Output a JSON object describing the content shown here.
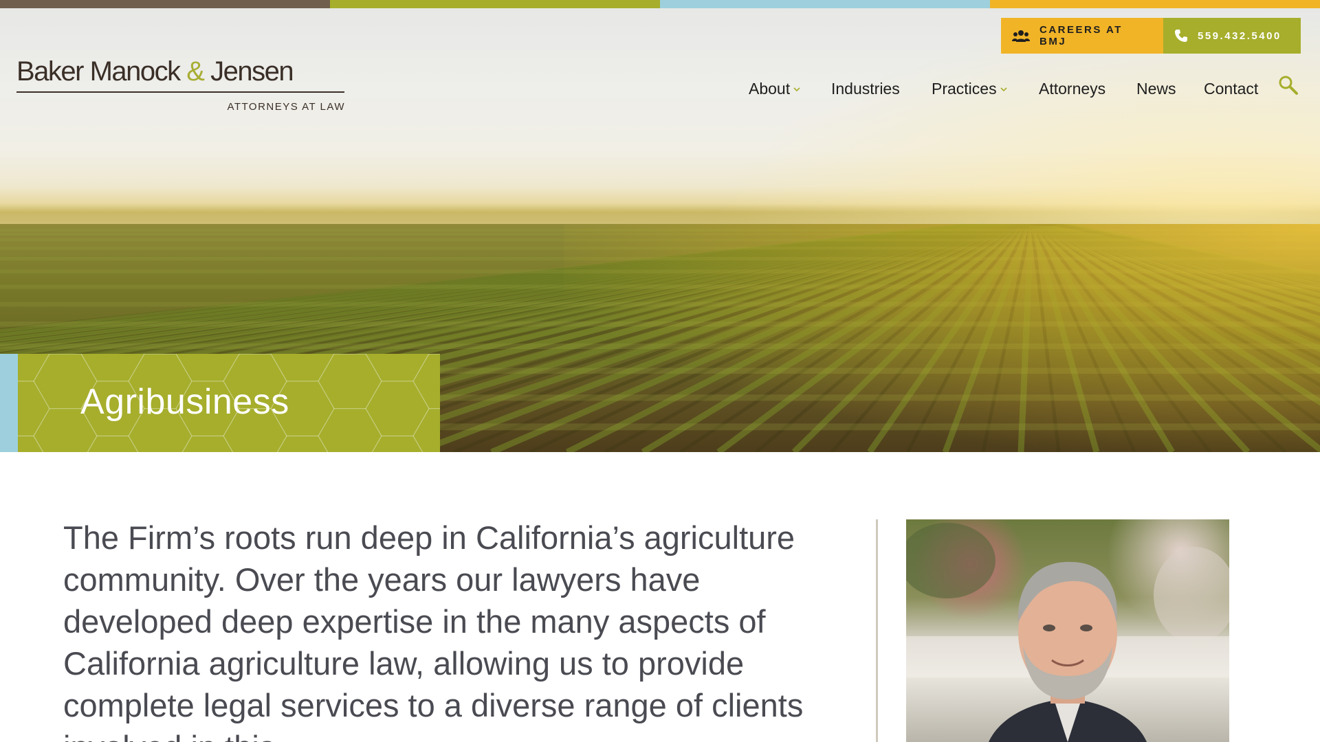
{
  "colors": {
    "strip": [
      "#6f5f4c",
      "#a6ae2c",
      "#9dd0dc",
      "#f1b427"
    ],
    "olive": "#a6ae2c",
    "gold": "#f1b427",
    "dark_text": "#1e1e1e",
    "body_text": "#4a4b52"
  },
  "logo": {
    "part1": "Baker Manock ",
    "amp": "&",
    "part2": " Jensen",
    "tagline": "ATTORNEYS AT LAW"
  },
  "utility": {
    "careers_label": "CAREERS AT BMJ",
    "careers_icon": "people-icon",
    "phone_label": "559.432.5400",
    "phone_icon": "phone-icon"
  },
  "nav": {
    "items": [
      {
        "label": "About",
        "has_dropdown": true
      },
      {
        "label": "Industries",
        "has_dropdown": false
      },
      {
        "label": "Practices",
        "has_dropdown": true
      },
      {
        "label": "Attorneys",
        "has_dropdown": false
      },
      {
        "label": "News",
        "has_dropdown": false
      },
      {
        "label": "Contact",
        "has_dropdown": false
      }
    ],
    "search_icon": "search-icon"
  },
  "hero": {
    "title": "Agribusiness"
  },
  "content": {
    "intro": "The Firm’s roots run deep in California’s agriculture community. Over the years our lawyers have developed deep expertise in the many aspects of California agriculture law, allowing us to provide complete legal services to a diverse range of clients involved in this"
  }
}
